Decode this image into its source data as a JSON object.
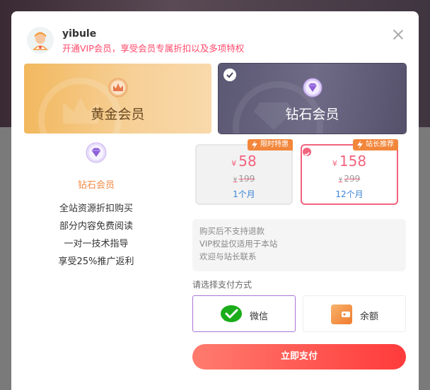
{
  "user": {
    "name": "yibule",
    "tagline": "开通VIP会员，享受会员专属折扣以及多项特权"
  },
  "tiers": [
    {
      "label": "黄金会员",
      "emblem": "crown-icon",
      "selected": false
    },
    {
      "label": "钻石会员",
      "emblem": "diamond-icon",
      "selected": true
    }
  ],
  "benefits": {
    "title": "钻石会员",
    "items": [
      "全站资源折扣购买",
      "部分内容免费阅读",
      "一对一技术指导",
      "享受25%推广返利"
    ]
  },
  "plans": [
    {
      "currency": "¥",
      "price": "58",
      "original": "199",
      "duration": "1个月",
      "badge": "限时特惠",
      "selected": false
    },
    {
      "currency": "¥",
      "price": "158",
      "original": "299",
      "duration": "12个月",
      "badge": "站长推荐",
      "selected": true
    }
  ],
  "notice": [
    "购买后不支持退款",
    "VIP权益仅适用于本站",
    "欢迎与站长联系"
  ],
  "payment": {
    "label": "请选择支付方式",
    "methods": [
      {
        "label": "微信",
        "icon": "wechat-icon",
        "selected": true
      },
      {
        "label": "余额",
        "icon": "wallet-icon",
        "selected": false
      }
    ]
  },
  "submit_label": "立即支付",
  "colors": {
    "accent": "#f2637e",
    "badge": "#f2863b",
    "link": "#3a83d8",
    "selected_border": "#a776d6"
  }
}
